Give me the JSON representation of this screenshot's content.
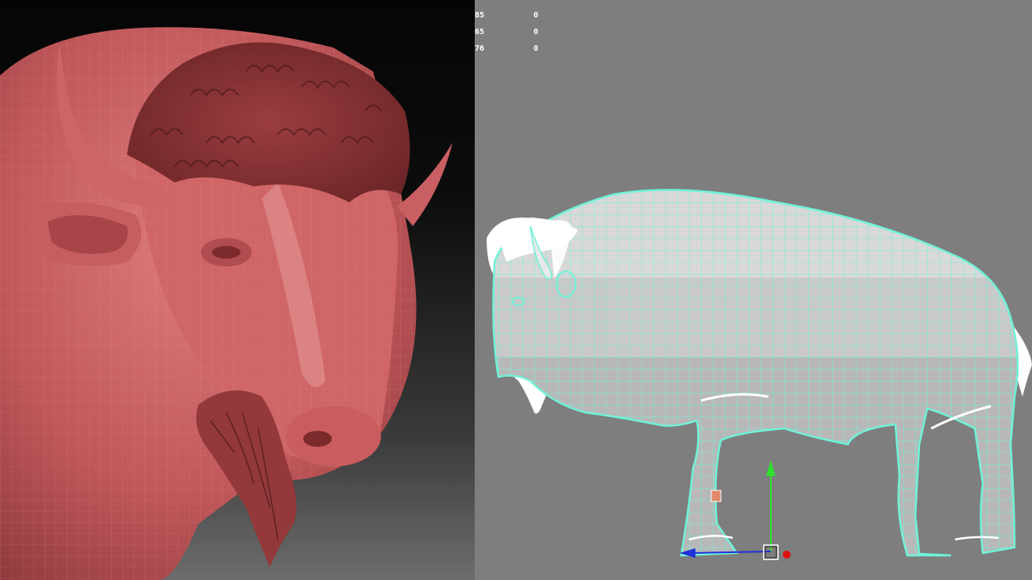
{
  "left_viewport": {
    "label": "",
    "background_top": "#050505",
    "background_bottom": "#6d6d6d",
    "model_color": "#c0575a"
  },
  "right_viewport": {
    "background": "#7e7e7e",
    "wireframe_color": "#6ff2d8",
    "stats": [
      {
        "value": "76",
        "count": "0"
      },
      {
        "value": "85",
        "count": "0"
      },
      {
        "value": "65",
        "count": "0"
      },
      {
        "value": "76",
        "count": "0"
      }
    ],
    "gizmo": {
      "y_axis_color": "#2fe02f",
      "x_axis_color": "#2030d8",
      "z_axis_color": "#e01010"
    }
  }
}
